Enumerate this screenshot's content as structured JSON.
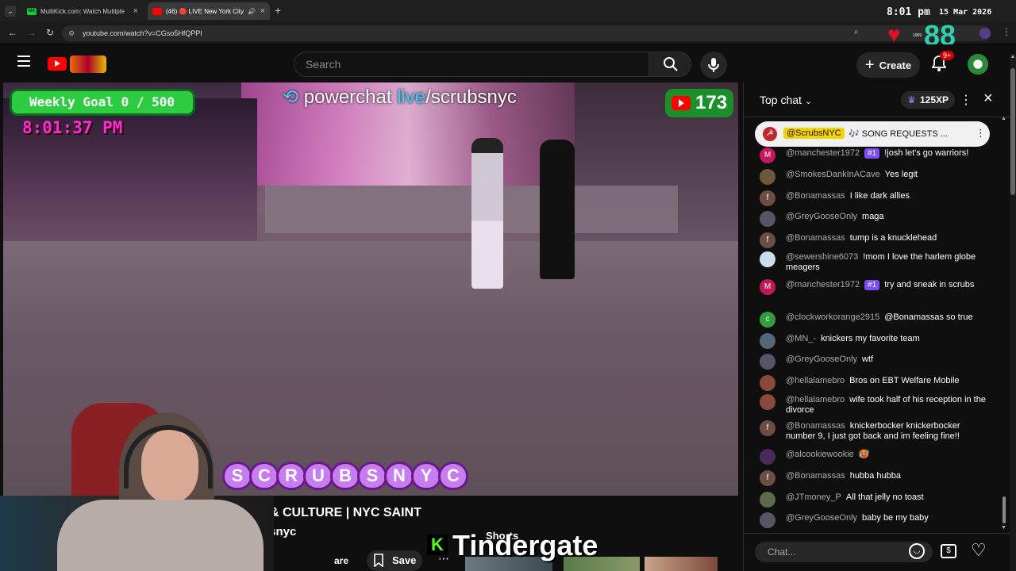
{
  "browser": {
    "tabs": [
      {
        "label": "MultiKick.com: Watch Multiple",
        "favicon": "MK"
      },
      {
        "label": "(46) 🔴 LIVE New York City",
        "favicon": "yt"
      }
    ],
    "url": "youtube.com/watch?v=CGso5HfQPPI",
    "clock": "8:01 pm",
    "date": "15 Mar 2026",
    "overlay_count": "88",
    "overlay_small": "1069"
  },
  "youtube": {
    "search_placeholder": "Search",
    "create_label": "Create",
    "notifications": "9+"
  },
  "video": {
    "weekly_goal": "Weekly Goal 0 / 500",
    "time": "8:01:37 PM",
    "powerchat_pre": "powerchat ",
    "powerchat_live": "live",
    "powerchat_post": "/scrubsnyc",
    "viewers": "173",
    "letters": [
      "S",
      "C",
      "R",
      "U",
      "B",
      "S",
      "N",
      "Y",
      "C"
    ],
    "title_fragment": "& CULTURE | NYC SAINT",
    "channel_fragment": "bsnyc",
    "share_fragment": "are",
    "save_label": "Save",
    "shorts_fragment": "Shorts",
    "stream_caption": "Tindergate",
    "kick_letter": "K"
  },
  "chat": {
    "header": "Top chat",
    "xp": "125XP",
    "pinned_author": "@ScrubsNYC",
    "pinned_text": "🎶 SONG REQUESTS ...",
    "input_placeholder": "Chat...",
    "messages": [
      {
        "author": "@manchester1972",
        "badge": "#1",
        "text": "!josh let's go warriors!",
        "avatar": "M",
        "color": "#c2185b"
      },
      {
        "author": "@SmokesDankInACave",
        "badge": "",
        "text": "Yes legit",
        "avatar": "",
        "color": "#6b5a3a"
      },
      {
        "author": "@Bonamassas",
        "badge": "",
        "text": "I like dark allies",
        "avatar": "f",
        "color": "#6d4c41"
      },
      {
        "author": "@GreyGooseOnly",
        "badge": "",
        "text": "maga",
        "avatar": "",
        "color": "#556"
      },
      {
        "author": "@Bonamassas",
        "badge": "",
        "text": "tump is a knucklehead",
        "avatar": "f",
        "color": "#6d4c41"
      },
      {
        "author": "@sewershine6073",
        "badge": "",
        "text": "!mom I love the harlem globe meagers",
        "avatar": "",
        "color": "#cde"
      },
      {
        "author": "@manchester1972",
        "badge": "#1",
        "text": "try and sneak in scrubs",
        "avatar": "M",
        "color": "#c2185b"
      },
      {
        "author": "@clockworkorange2915",
        "badge": "",
        "text": "@Bonamassas so true",
        "avatar": "c",
        "color": "#2e9e3e"
      },
      {
        "author": "@MN_-",
        "badge": "",
        "text": "knickers my favorite team",
        "avatar": "",
        "color": "#567"
      },
      {
        "author": "@GreyGooseOnly",
        "badge": "",
        "text": "wtf",
        "avatar": "",
        "color": "#556"
      },
      {
        "author": "@hellalamebro",
        "badge": "",
        "text": "Bros on EBT Welfare Mobile",
        "avatar": "",
        "color": "#8a4a3a"
      },
      {
        "author": "@hellalamebro",
        "badge": "",
        "text": "wife took half of his reception in the divorce",
        "avatar": "",
        "color": "#8a4a3a"
      },
      {
        "author": "@Bonamassas",
        "badge": "",
        "text": "knickerbocker knickerbocker number 9, I just got back and im feeling fine!!",
        "avatar": "f",
        "color": "#6d4c41"
      },
      {
        "author": "@alcookiewookie",
        "badge": "",
        "text": "🥵",
        "avatar": "",
        "color": "#4a2a5a"
      },
      {
        "author": "@Bonamassas",
        "badge": "",
        "text": "hubba hubba",
        "avatar": "f",
        "color": "#6d4c41"
      },
      {
        "author": "@JTmoney_P",
        "badge": "",
        "text": "All that jelly no toast",
        "avatar": "",
        "color": "#5a6a4a"
      },
      {
        "author": "@GreyGooseOnly",
        "badge": "",
        "text": "baby be my baby",
        "avatar": "",
        "color": "#556"
      }
    ]
  }
}
